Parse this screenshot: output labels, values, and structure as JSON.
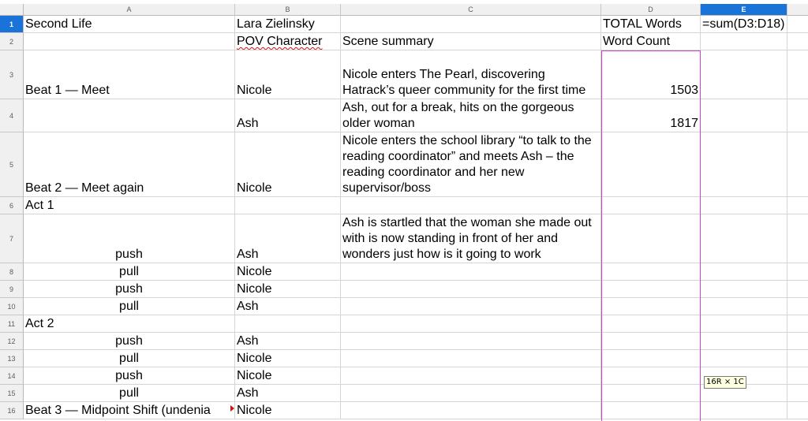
{
  "columns": [
    "A",
    "B",
    "C",
    "D",
    "E"
  ],
  "selected_column": "E",
  "rows": {
    "r1": {
      "num": "1",
      "A": "Second Life",
      "B": "Lara Zielinsky",
      "C": "",
      "D": "TOTAL Words",
      "E": "=sum(D3:D18)"
    },
    "r2": {
      "num": "2",
      "A": "",
      "B": "POV Character",
      "C": "Scene summary",
      "D": "Word Count",
      "E": ""
    },
    "r3": {
      "num": "3",
      "A": "Beat 1 — Meet",
      "B": "Nicole",
      "C": "Nicole enters The Pearl, discovering Hatrack’s queer community for the first time",
      "D": "1503",
      "E": ""
    },
    "r4": {
      "num": "4",
      "A": "",
      "B": "Ash",
      "C": "Ash, out for a break, hits on the gorgeous older woman",
      "D": "1817",
      "E": ""
    },
    "r5": {
      "num": "5",
      "A": "Beat 2 — Meet again",
      "B": "Nicole",
      "C": "Nicole enters the school library “to talk to the reading coordinator” and meets Ash – the reading coordinator and her new supervisor/boss",
      "D": "",
      "E": ""
    },
    "r6": {
      "num": "6",
      "A": "Act 1",
      "B": "",
      "C": "",
      "D": "",
      "E": ""
    },
    "r7": {
      "num": "7",
      "A": "push",
      "B": "Ash",
      "C": "Ash is startled that the woman she made out with is now standing in front of her and wonders just how is it going to work",
      "D": "",
      "E": ""
    },
    "r8": {
      "num": "8",
      "A": "pull",
      "B": "Nicole",
      "C": "",
      "D": "",
      "E": ""
    },
    "r9": {
      "num": "9",
      "A": "push",
      "B": "Nicole",
      "C": "",
      "D": "",
      "E": ""
    },
    "r10": {
      "num": "10",
      "A": "pull",
      "B": "Ash",
      "C": "",
      "D": "",
      "E": ""
    },
    "r11": {
      "num": "11",
      "A": "Act 2",
      "B": "",
      "C": "",
      "D": "",
      "E": ""
    },
    "r12": {
      "num": "12",
      "A": "push",
      "B": "Ash",
      "C": "",
      "D": "",
      "E": ""
    },
    "r13": {
      "num": "13",
      "A": "pull",
      "B": "Nicole",
      "C": "",
      "D": "",
      "E": ""
    },
    "r14": {
      "num": "14",
      "A": "push",
      "B": "Nicole",
      "C": "",
      "D": "",
      "E": ""
    },
    "r15": {
      "num": "15",
      "A": "pull",
      "B": "Ash",
      "C": "",
      "D": "",
      "E": ""
    },
    "r16": {
      "num": "16",
      "A": "Beat 3 — Midpoint Shift (undenia",
      "B": "Nicole",
      "C": "",
      "D": "",
      "E": ""
    }
  },
  "selection_tooltip": "16R × 1C",
  "colors": {
    "selection_header": "#1a73d9",
    "range_border": "#cc44cc",
    "spell_error": "#d01010"
  }
}
